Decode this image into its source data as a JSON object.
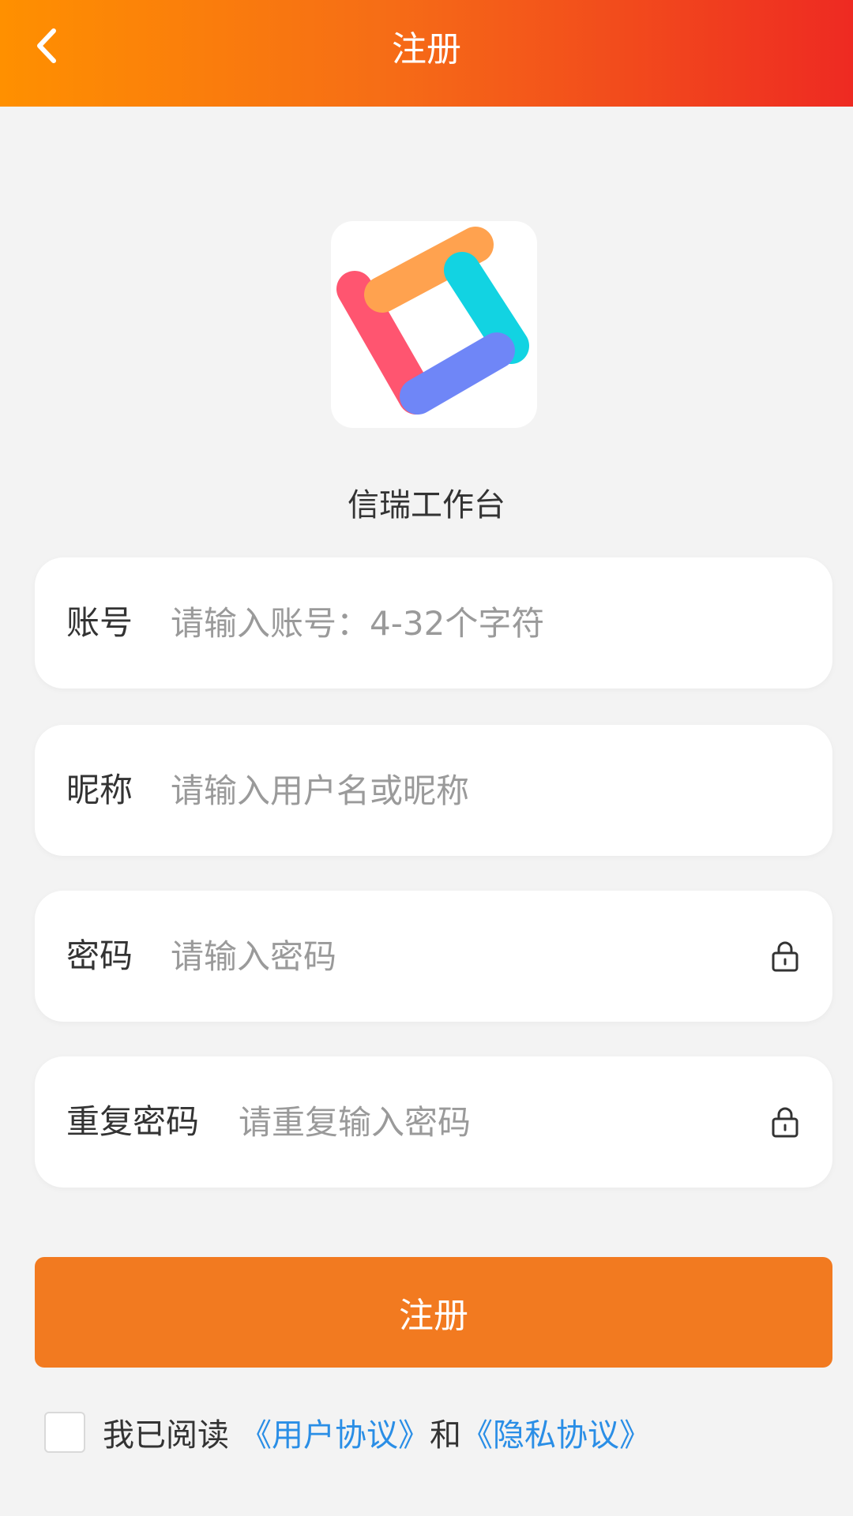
{
  "header": {
    "title": "注册",
    "back_icon": "chevron-left-icon",
    "gradient_start": "#ff9000",
    "gradient_end": "#ee2a22"
  },
  "app": {
    "name": "信瑞工作台",
    "logo_colors": [
      "#ff5570",
      "#ffa24f",
      "#12d3e2",
      "#6f86f7"
    ]
  },
  "form": {
    "fields": [
      {
        "label": "账号",
        "placeholder": "请输入账号：4-32个字符",
        "value": ""
      },
      {
        "label": "昵称",
        "placeholder": "请输入用户名或昵称",
        "value": ""
      },
      {
        "label": "密码",
        "placeholder": "请输入密码",
        "value": "",
        "icon": "lock-icon"
      },
      {
        "label": "重复密码",
        "placeholder": "请重复输入密码",
        "value": "",
        "icon": "lock-icon"
      }
    ],
    "submit_label": "注册",
    "submit_color": "#f27a20"
  },
  "agreement": {
    "prefix": "我已阅读",
    "user_agreement": "《用户协议》",
    "conjunction": "和",
    "privacy_agreement": "《隐私协议》",
    "checked": false,
    "link_color": "#2a8ee6"
  }
}
